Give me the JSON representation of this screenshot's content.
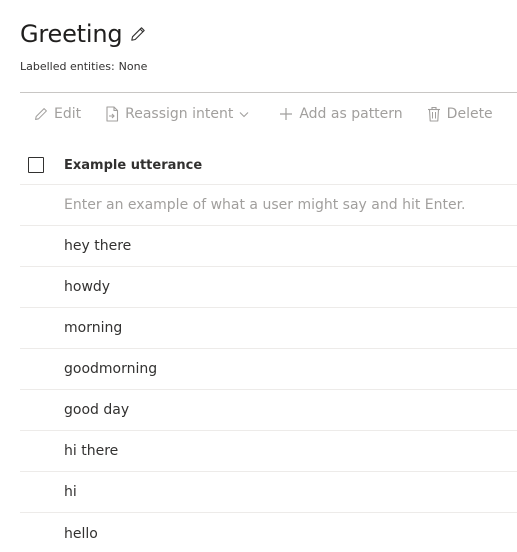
{
  "header": {
    "title": "Greeting",
    "edit_icon": "pencil-icon",
    "labelled_entities_label": "Labelled entities:",
    "labelled_entities_value": "None"
  },
  "toolbar": {
    "edit_label": "Edit",
    "reassign_label": "Reassign intent",
    "add_pattern_label": "Add as pattern",
    "delete_label": "Delete",
    "icons": {
      "edit": "pencil-icon",
      "reassign": "reassign-document-icon",
      "reassign_dropdown": "chevron-down-icon",
      "add": "plus-icon",
      "delete": "trash-icon"
    },
    "disabled_color": "#a19f9d"
  },
  "grid": {
    "column_header": "Example utterance",
    "input_placeholder": "Enter an example of what a user might say and hit Enter.",
    "input_value": "",
    "rows": [
      "hey there",
      "howdy",
      "morning",
      "goodmorning",
      "good day",
      "hi there",
      "hi",
      "hello"
    ]
  }
}
